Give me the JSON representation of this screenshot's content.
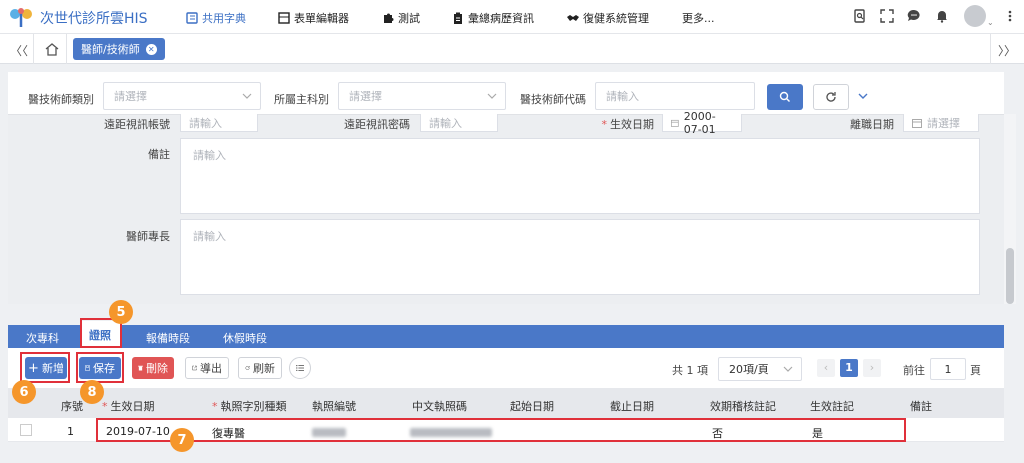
{
  "app": {
    "title": "次世代診所雲HIS"
  },
  "nav": {
    "items": [
      {
        "label": "共用字典"
      },
      {
        "label": "表單編輯器"
      },
      {
        "label": "測試"
      },
      {
        "label": "彙總病歷資訊"
      },
      {
        "label": "復健系統管理"
      },
      {
        "label": "更多..."
      }
    ]
  },
  "tabs": {
    "open": "醫師/技術師",
    "left_nav": "〈〈",
    "right_nav": "〉〉"
  },
  "search": {
    "category_label": "醫技術師類別",
    "category_placeholder": "請選擇",
    "dept_label": "所屬主科別",
    "dept_placeholder": "請選擇",
    "code_label": "醫技術師代碼",
    "code_placeholder": "請輸入"
  },
  "form": {
    "video_account_label": "遠距視訊帳號",
    "video_account_placeholder": "請輸入",
    "video_password_label": "遠距視訊密碼",
    "video_password_placeholder": "請輸入",
    "effective_date_label": "生效日期",
    "effective_date_value": "2000-07-01",
    "leave_date_label": "離職日期",
    "leave_date_placeholder": "請選擇",
    "remark_label": "備註",
    "remark_placeholder": "請輸入",
    "specialty_label": "醫師專長",
    "specialty_placeholder": "請輸入"
  },
  "subtabs": {
    "items": [
      "次專科",
      "證照",
      "報備時段",
      "休假時段"
    ],
    "active": "證照"
  },
  "toolbar": {
    "add": "新增",
    "save": "保存",
    "delete": "刪除",
    "export": "導出",
    "refresh": "刷新",
    "total": "共 1 項",
    "page_size": "20項/頁",
    "current_page": "1",
    "goto_label": "前往",
    "goto_value": "1",
    "page_unit": "頁"
  },
  "table": {
    "headers": [
      "序號",
      "生效日期",
      "執照字別種類",
      "執照編號",
      "中文執照碼",
      "起始日期",
      "截止日期",
      "效期稽核註記",
      "生效註記",
      "備註"
    ],
    "rows": [
      {
        "seq": "1",
        "effective_date": "2019-07-10",
        "license_type": "復專醫",
        "license_no": "",
        "cn_code": "",
        "start": "",
        "end": "",
        "audit": "否",
        "active": "是",
        "remark": ""
      }
    ]
  },
  "annotations": {
    "badge5": "5",
    "badge6": "6",
    "badge7": "7",
    "badge8": "8"
  },
  "colors": {
    "primary": "#4a78c8",
    "danger": "#e05555",
    "annotation": "#e0303a",
    "badge": "#f5962b"
  }
}
